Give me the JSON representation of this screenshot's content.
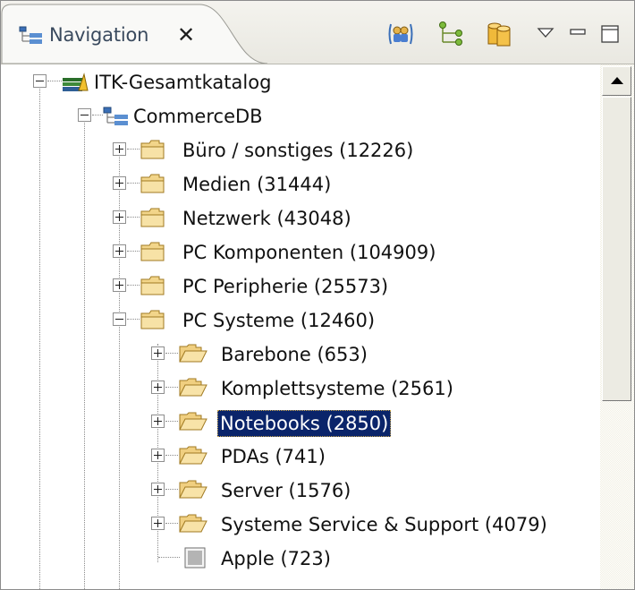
{
  "view": {
    "tab_icon": "navigation-tree-icon",
    "title": "Navigation",
    "close_symbol": "✕"
  },
  "toolbar": {
    "items": [
      {
        "icon": "users-icon"
      },
      {
        "icon": "hierarchy-icon"
      },
      {
        "icon": "database-icon"
      },
      {
        "icon": "view-menu-triangle-icon"
      },
      {
        "icon": "minimize-icon"
      },
      {
        "icon": "maximize-icon"
      }
    ]
  },
  "colors": {
    "selection_bg": "#0a246a",
    "selection_fg": "#ffffff",
    "tab_text": "#3a4a5e"
  },
  "tree": {
    "items": [
      {
        "label": "ITK-Gesamtkatalog",
        "icon": "catalog-icon",
        "expander": "minus",
        "selected": false
      },
      {
        "label": "CommerceDB",
        "icon": "database-tree-icon",
        "expander": "minus",
        "selected": false
      },
      {
        "label": "Büro / sonstiges (12226)",
        "icon": "folder-closed-icon",
        "expander": "plus",
        "selected": false
      },
      {
        "label": "Medien (31444)",
        "icon": "folder-closed-icon",
        "expander": "plus",
        "selected": false
      },
      {
        "label": "Netzwerk (43048)",
        "icon": "folder-closed-icon",
        "expander": "plus",
        "selected": false
      },
      {
        "label": "PC Komponenten (104909)",
        "icon": "folder-closed-icon",
        "expander": "plus",
        "selected": false
      },
      {
        "label": "PC Peripherie (25573)",
        "icon": "folder-closed-icon",
        "expander": "plus",
        "selected": false
      },
      {
        "label": "PC Systeme (12460)",
        "icon": "folder-closed-icon",
        "expander": "minus",
        "selected": false
      },
      {
        "label": "Barebone (653)",
        "icon": "folder-open-icon",
        "expander": "plus",
        "selected": false
      },
      {
        "label": "Komplettsysteme (2561)",
        "icon": "folder-open-icon",
        "expander": "plus",
        "selected": false
      },
      {
        "label": "Notebooks (2850)",
        "icon": "folder-open-icon",
        "expander": "plus",
        "selected": true
      },
      {
        "label": "PDAs (741)",
        "icon": "folder-open-icon",
        "expander": "plus",
        "selected": false
      },
      {
        "label": "Server (1576)",
        "icon": "folder-open-icon",
        "expander": "plus",
        "selected": false
      },
      {
        "label": "Systeme Service & Support (4079)",
        "icon": "folder-open-icon",
        "expander": "plus",
        "selected": false
      },
      {
        "label": "Apple (723)",
        "icon": "leaf-item-icon",
        "expander": "none",
        "selected": false
      }
    ]
  },
  "scrollbar": {
    "up_arrow_icon": "scroll-up-arrow-icon"
  }
}
